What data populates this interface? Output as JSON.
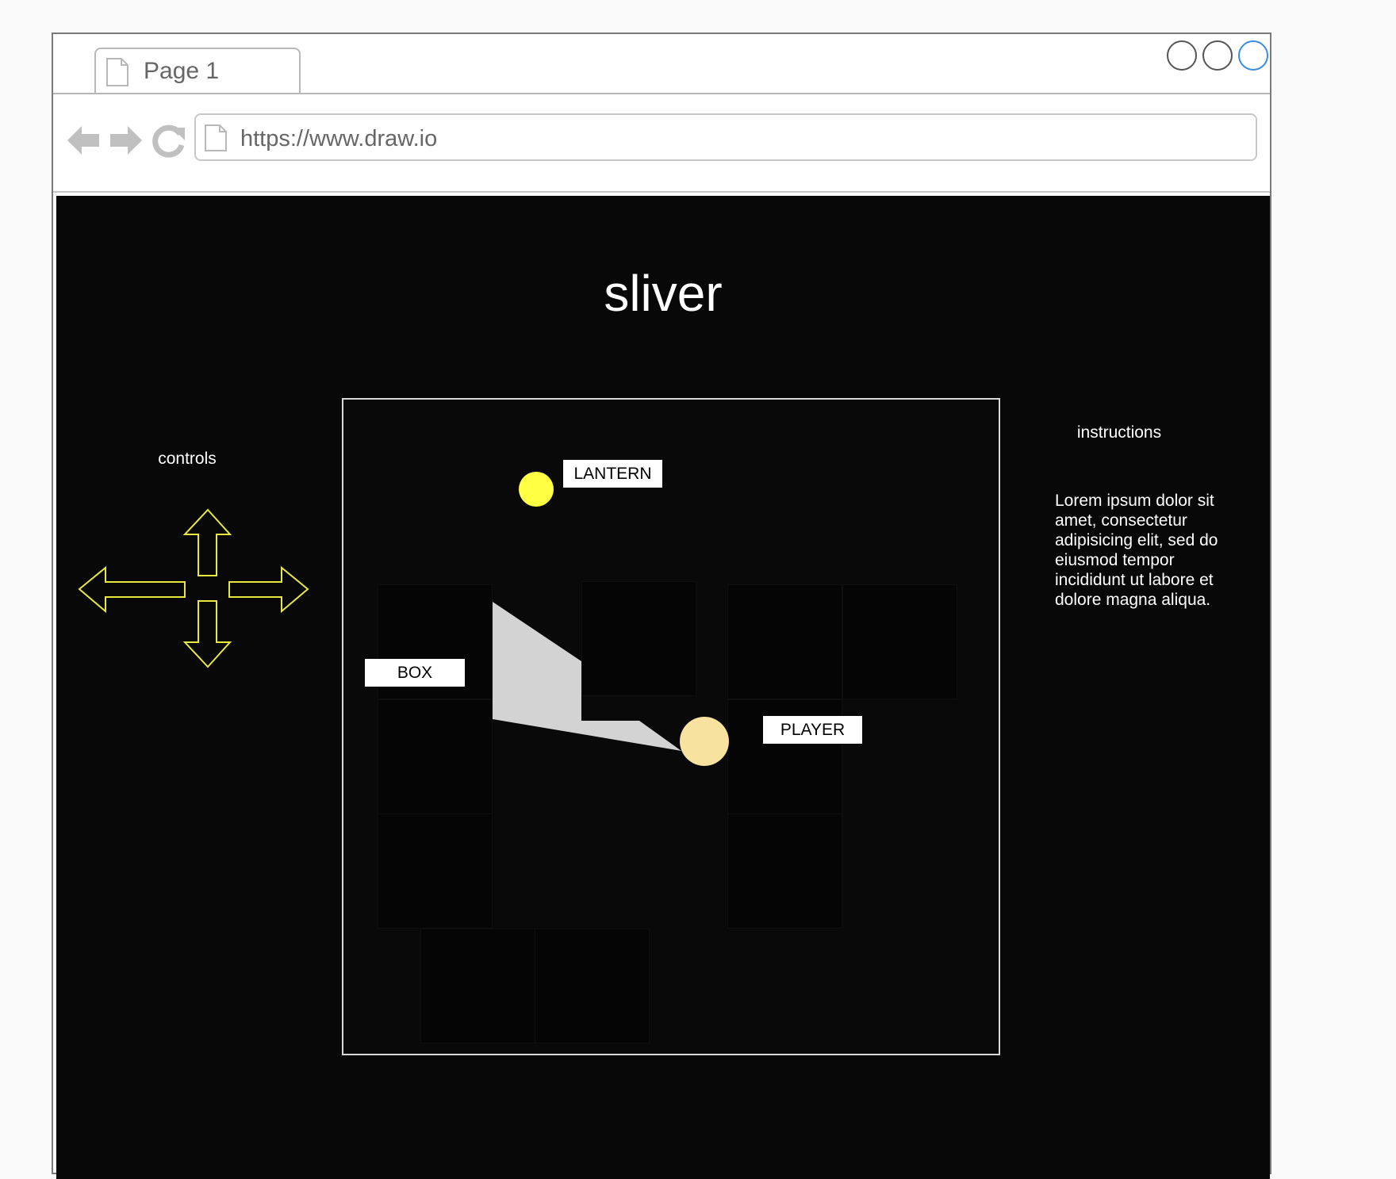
{
  "browser": {
    "tab_label": "Page 1",
    "url": "https://www.draw.io",
    "window_controls": [
      "circle",
      "circle",
      "circle"
    ],
    "accent_color": "#3a8de0"
  },
  "page": {
    "title": "sliver",
    "controls_label": "controls",
    "instructions_label": "instructions",
    "instructions_text": "Lorem ipsum dolor sit amet, consectetur adipisicing elit, sed do eiusmod tempor incididunt ut labore et dolore magna aliqua.",
    "background_color": "#080808",
    "arrow_color": "#e8e840"
  },
  "game": {
    "lantern_label": "LANTERN",
    "box_label": "BOX",
    "player_label": "PLAYER",
    "lantern_color": "#ffff44",
    "player_color": "#f8e2a0",
    "light_color": "#d3d3d3"
  }
}
